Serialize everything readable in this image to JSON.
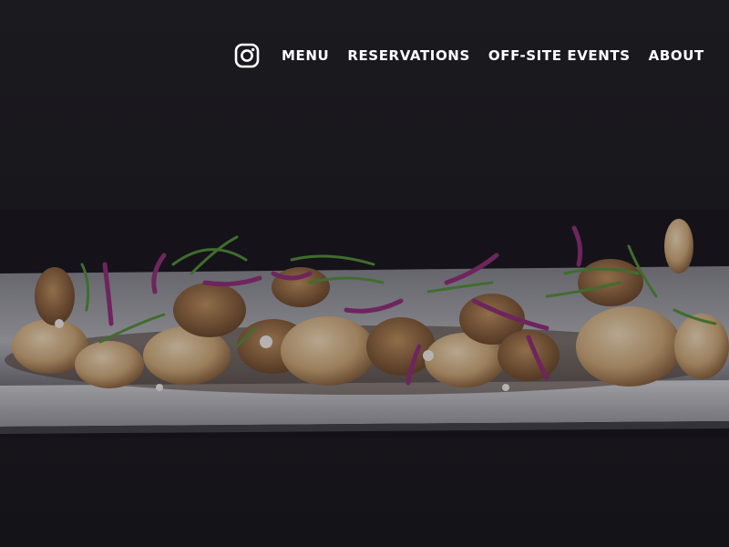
{
  "nav": {
    "instagram_icon": "instagram-icon",
    "items": [
      {
        "label": "MENU"
      },
      {
        "label": "RESERVATIONS"
      },
      {
        "label": "OFF-SITE EVENTS"
      },
      {
        "label": "ABOUT"
      }
    ]
  },
  "colors": {
    "background": "#17161b",
    "nav_text": "#ffffff",
    "plate": "#cfd0d4",
    "cauliflower": "#c9a87d",
    "red_cabbage": "#8a2e72",
    "scallion": "#4f8a35"
  }
}
